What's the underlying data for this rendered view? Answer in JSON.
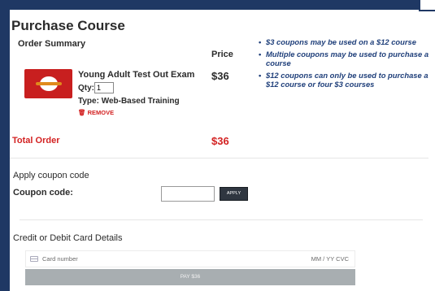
{
  "page": {
    "title": "Purchase Course"
  },
  "order_summary": {
    "heading": "Order Summary",
    "price_header": "Price",
    "item": {
      "thumbnail_label": "Test Out",
      "name": "Young Adult Test Out Exam",
      "qty_label": "Qty:",
      "qty_value": "1",
      "type": "Type: Web-Based Training",
      "remove_label": "REMOVE",
      "price": "$36"
    },
    "total_label": "Total Order",
    "total_value": "$36"
  },
  "coupon_notes": [
    "$3 coupons may be used on a $12 course",
    "Multiple coupons may be used to purchase a course",
    "$12 coupons can only be used to purchase a $12 course or four $3 courses"
  ],
  "coupon": {
    "heading": "Apply coupon code",
    "label": "Coupon code:",
    "value": "",
    "apply_label": "APPLY"
  },
  "payment": {
    "heading": "Credit or Debit Card Details",
    "card_placeholder": "Card number",
    "expiry_cvc": "MM / YY  CVC",
    "pay_label": "PAY $36"
  },
  "colors": {
    "frame": "#1f3864",
    "accent_red": "#d32222",
    "note_blue": "#1f3f7a",
    "pay_button": "#a8aeb1"
  }
}
